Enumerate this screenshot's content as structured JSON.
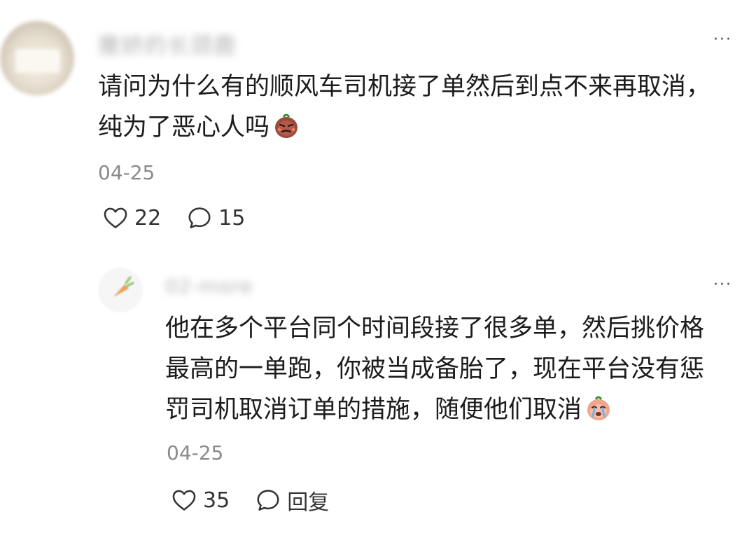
{
  "comments": [
    {
      "username": "撒娇的长颈鹿",
      "text": "请问为什么有的顺风车司机接了单然后到点不来再取消，纯为了恶心人吗",
      "emoji": "angry-sweet-potato-emoji",
      "date": "04-25",
      "like_count": "22",
      "reply_count": "15"
    },
    {
      "username": "02-more",
      "text": "他在多个平台同个时间段接了很多单，然后挑价格最高的一单跑，你被当成备胎了，现在平台没有惩罚司机取消订单的措施，随便他们取消",
      "emoji": "crying-sweet-potato-emoji",
      "date": "04-25",
      "like_count": "35",
      "reply_label": "回复"
    }
  ],
  "icons": {
    "more": "more-dots-icon",
    "like": "heart-outline-icon",
    "comment": "comment-bubble-icon"
  },
  "more_glyph": "···",
  "colors": {
    "text": "#1c1c1c",
    "meta": "#8a8a8a",
    "icon": "#333333"
  }
}
